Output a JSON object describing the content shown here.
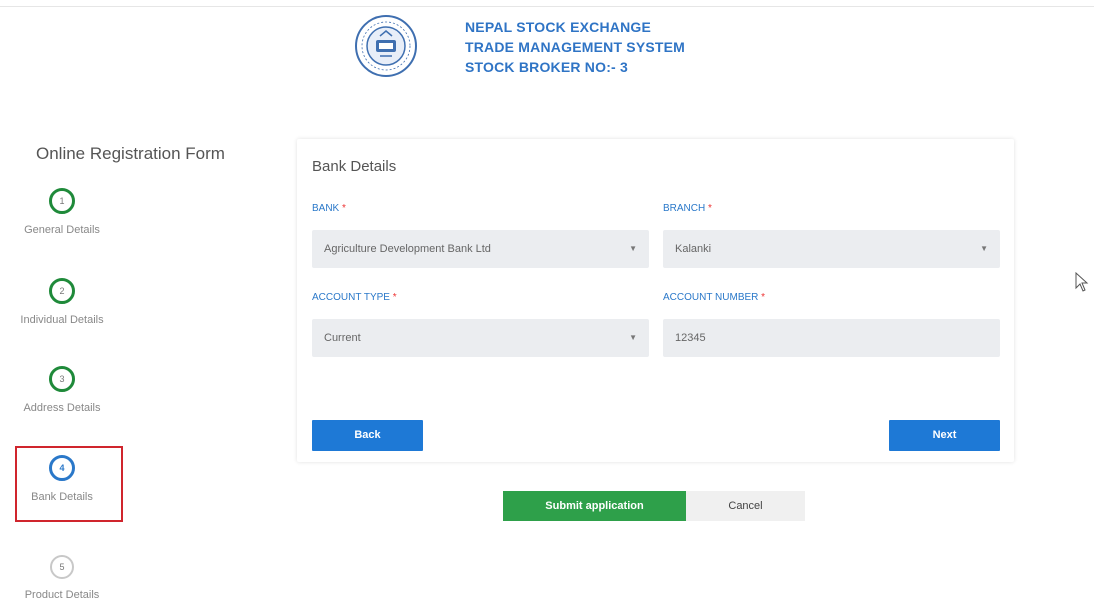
{
  "header": {
    "line1": "NEPAL STOCK EXCHANGE",
    "line2": "TRADE MANAGEMENT SYSTEM",
    "line3": "STOCK BROKER NO:- 3",
    "logo_text_top": "NEPAL STOCK EXCHANGE LTD",
    "logo_year": "1993"
  },
  "sidebar": {
    "title": "Online Registration Form",
    "steps": [
      {
        "number": "1",
        "label": "General Details",
        "state": "done"
      },
      {
        "number": "2",
        "label": "Individual Details",
        "state": "done"
      },
      {
        "number": "3",
        "label": "Address Details",
        "state": "done"
      },
      {
        "number": "4",
        "label": "Bank Details",
        "state": "active"
      },
      {
        "number": "5",
        "label": "Product Details",
        "state": "todo"
      }
    ]
  },
  "card": {
    "title": "Bank Details",
    "bank": {
      "label": "BANK",
      "value": "Agriculture Development Bank Ltd"
    },
    "branch": {
      "label": "BRANCH",
      "value": "Kalanki"
    },
    "account_type": {
      "label": "ACCOUNT TYPE",
      "value": "Current"
    },
    "account_number": {
      "label": "ACCOUNT NUMBER",
      "value": "12345"
    },
    "required_mark": "*",
    "back_label": "Back",
    "next_label": "Next"
  },
  "actions": {
    "submit_label": "Submit application",
    "cancel_label": "Cancel"
  },
  "colors": {
    "primary": "#1e79d6",
    "success": "#2ea04a",
    "step_done": "#1f8a3a",
    "highlight": "#d0252d"
  }
}
